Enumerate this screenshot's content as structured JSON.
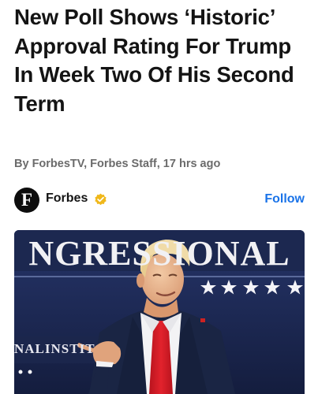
{
  "article": {
    "headline": "New Poll Shows ‘Historic’ Approval Rating For Trump In Week Two Of His Second Term",
    "byline": "By ForbesTV, Forbes Staff, 17 hrs ago"
  },
  "source": {
    "logo_letter": "F",
    "name": "Forbes",
    "follow_label": "Follow",
    "verified_color": "#f0b81b",
    "follow_color": "#1a73e8"
  },
  "hero_image": {
    "banner_text": "NGRESSIONAL",
    "small_banner_text": "NALINSTIT"
  }
}
